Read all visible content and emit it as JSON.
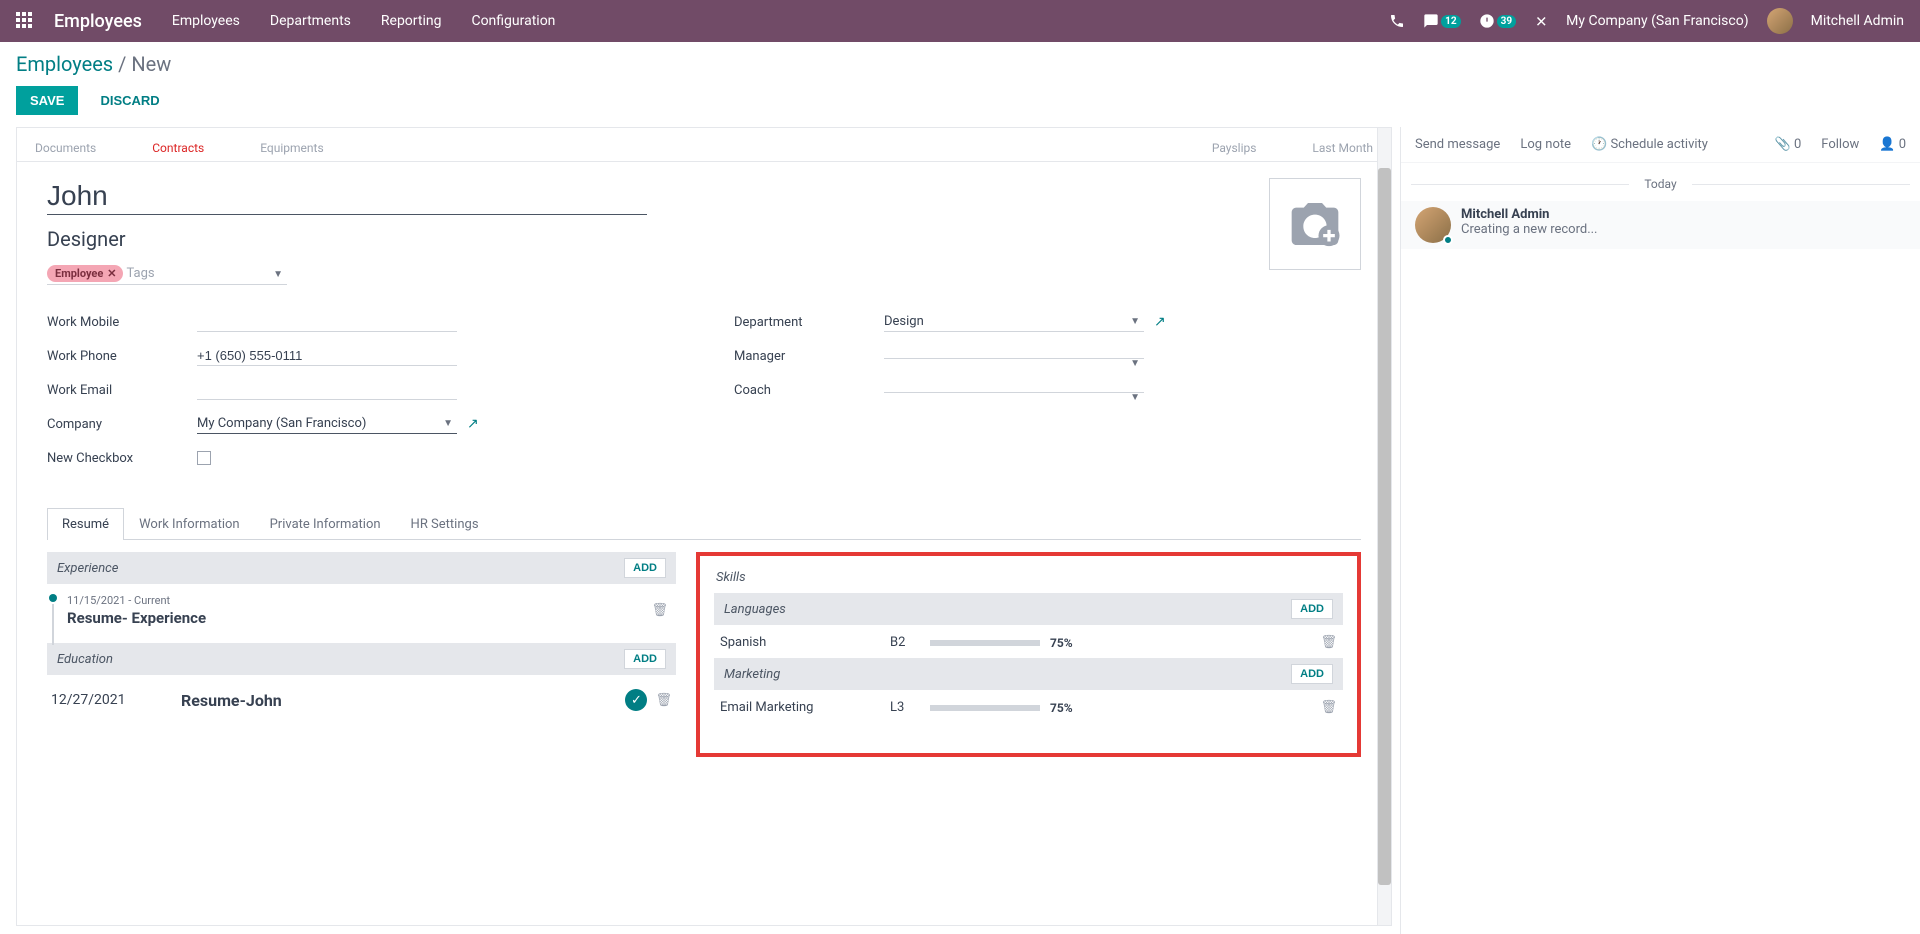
{
  "topbar": {
    "app_title": "Employees",
    "menu": [
      "Employees",
      "Departments",
      "Reporting",
      "Configuration"
    ],
    "messages_badge": "12",
    "activities_badge": "39",
    "company": "My Company (San Francisco)",
    "user": "Mitchell Admin"
  },
  "breadcrumb": {
    "parent": "Employees",
    "sep": "/",
    "current": "New"
  },
  "buttons": {
    "save": "SAVE",
    "discard": "DISCARD"
  },
  "button_row": {
    "documents": "Documents",
    "contracts": "Contracts",
    "equipments": "Equipments",
    "payslips": "Payslips",
    "last_month": "Last Month"
  },
  "employee": {
    "name": "John",
    "job_title": "Designer",
    "tag": "Employee",
    "tags_placeholder": "Tags",
    "labels": {
      "work_mobile": "Work Mobile",
      "work_phone": "Work Phone",
      "work_email": "Work Email",
      "company": "Company",
      "new_checkbox": "New Checkbox",
      "department": "Department",
      "manager": "Manager",
      "coach": "Coach"
    },
    "values": {
      "work_mobile": "",
      "work_phone": "+1 (650) 555-0111",
      "work_email": "",
      "company": "My Company (San Francisco)",
      "department": "Design",
      "manager": "",
      "coach": ""
    }
  },
  "tabs": [
    "Resumé",
    "Work Information",
    "Private Information",
    "HR Settings"
  ],
  "resume": {
    "experience_header": "Experience",
    "add": "ADD",
    "exp_date": "11/15/2021 - Current",
    "exp_title": "Resume- Experience",
    "education_header": "Education",
    "edu_date": "12/27/2021",
    "edu_title": "Resume-John"
  },
  "skills": {
    "header": "Skills",
    "add": "ADD",
    "groups": [
      {
        "name": "Languages",
        "items": [
          {
            "name": "Spanish",
            "level": "B2",
            "pct": "75%",
            "bar": 75
          }
        ]
      },
      {
        "name": "Marketing",
        "items": [
          {
            "name": "Email Marketing",
            "level": "L3",
            "pct": "75%",
            "bar": 75
          }
        ]
      }
    ]
  },
  "chatter": {
    "send_message": "Send message",
    "log_note": "Log note",
    "schedule": "Schedule activity",
    "attach_count": "0",
    "follow": "Follow",
    "follower_count": "0",
    "today": "Today",
    "msg_author": "Mitchell Admin",
    "msg_body": "Creating a new record..."
  }
}
